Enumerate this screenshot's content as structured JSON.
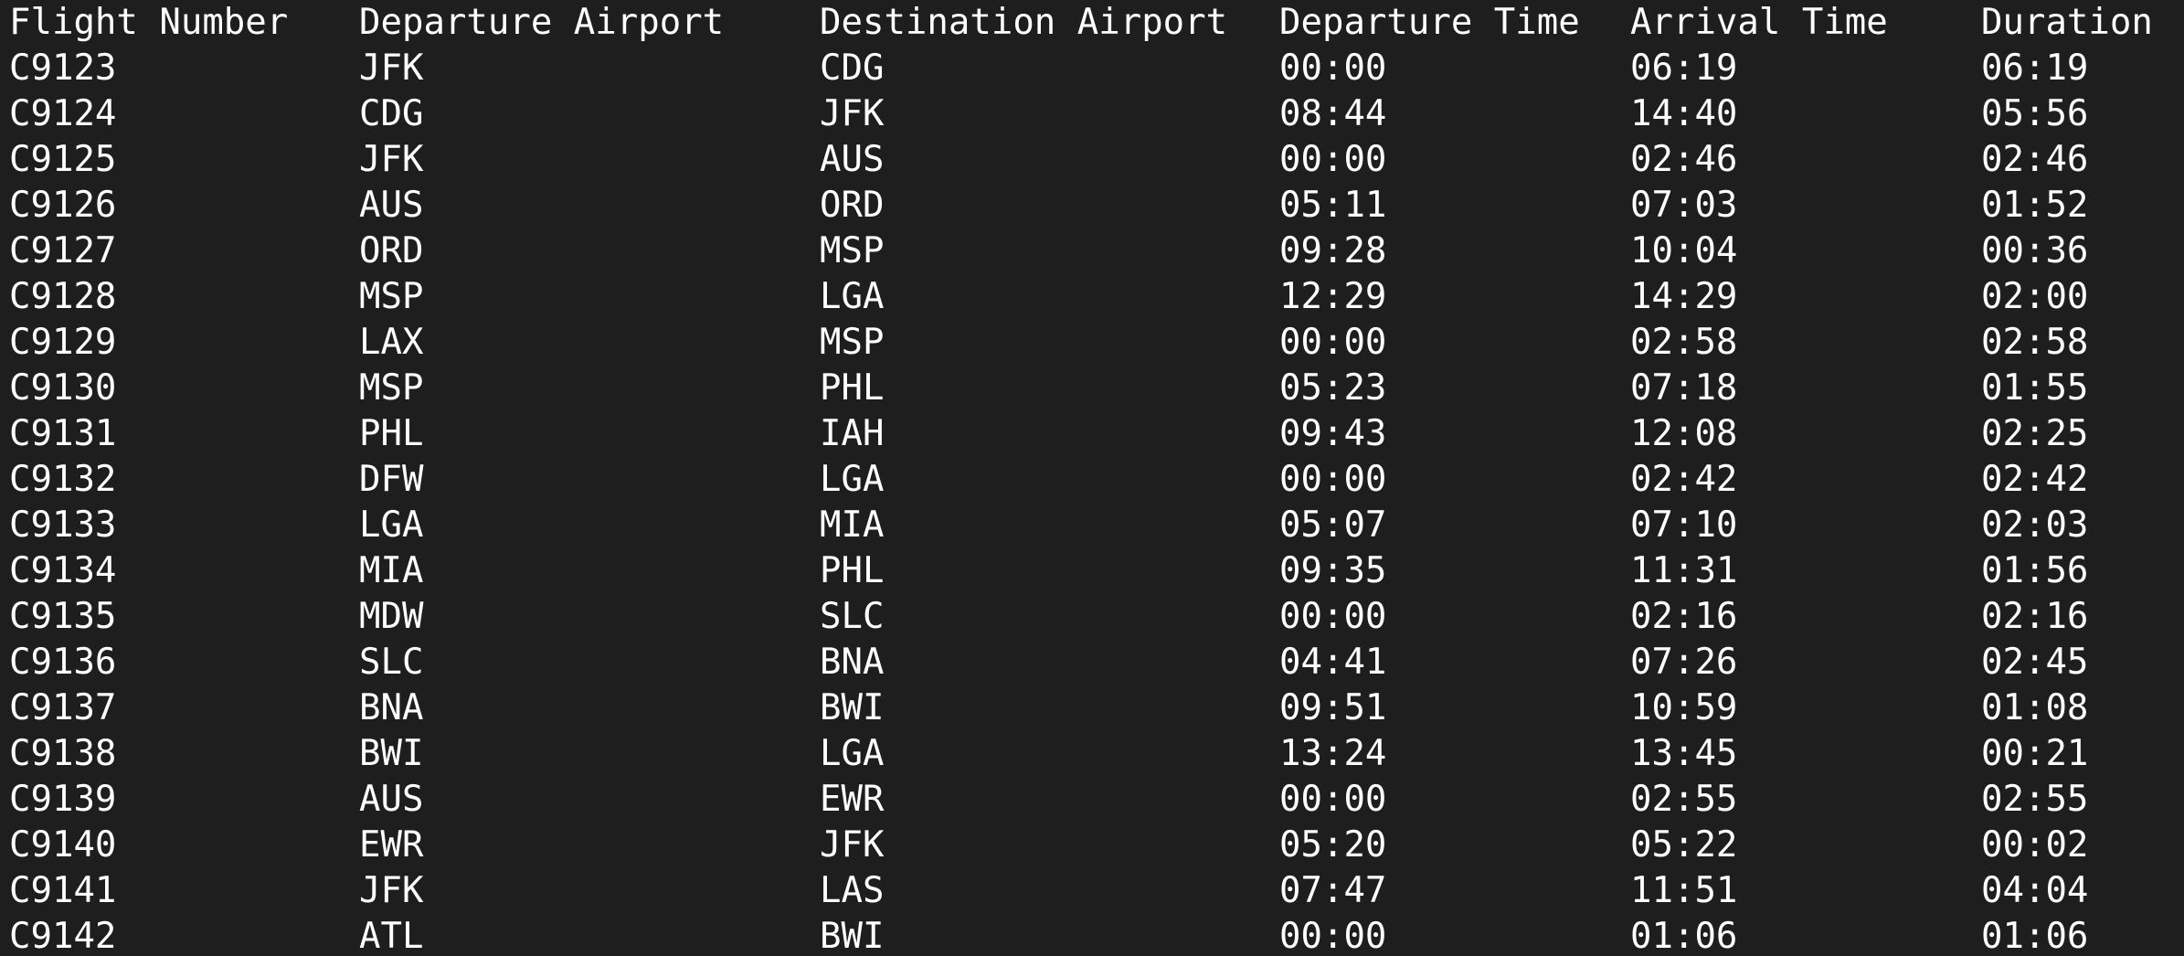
{
  "table": {
    "headers": [
      "Flight Number",
      "Departure Airport",
      "Destination Airport",
      "Departure Time",
      "Arrival Time",
      "Duration"
    ],
    "rows": [
      [
        "C9123",
        "JFK",
        "CDG",
        "00:00",
        "06:19",
        "06:19"
      ],
      [
        "C9124",
        "CDG",
        "JFK",
        "08:44",
        "14:40",
        "05:56"
      ],
      [
        "C9125",
        "JFK",
        "AUS",
        "00:00",
        "02:46",
        "02:46"
      ],
      [
        "C9126",
        "AUS",
        "ORD",
        "05:11",
        "07:03",
        "01:52"
      ],
      [
        "C9127",
        "ORD",
        "MSP",
        "09:28",
        "10:04",
        "00:36"
      ],
      [
        "C9128",
        "MSP",
        "LGA",
        "12:29",
        "14:29",
        "02:00"
      ],
      [
        "C9129",
        "LAX",
        "MSP",
        "00:00",
        "02:58",
        "02:58"
      ],
      [
        "C9130",
        "MSP",
        "PHL",
        "05:23",
        "07:18",
        "01:55"
      ],
      [
        "C9131",
        "PHL",
        "IAH",
        "09:43",
        "12:08",
        "02:25"
      ],
      [
        "C9132",
        "DFW",
        "LGA",
        "00:00",
        "02:42",
        "02:42"
      ],
      [
        "C9133",
        "LGA",
        "MIA",
        "05:07",
        "07:10",
        "02:03"
      ],
      [
        "C9134",
        "MIA",
        "PHL",
        "09:35",
        "11:31",
        "01:56"
      ],
      [
        "C9135",
        "MDW",
        "SLC",
        "00:00",
        "02:16",
        "02:16"
      ],
      [
        "C9136",
        "SLC",
        "BNA",
        "04:41",
        "07:26",
        "02:45"
      ],
      [
        "C9137",
        "BNA",
        "BWI",
        "09:51",
        "10:59",
        "01:08"
      ],
      [
        "C9138",
        "BWI",
        "LGA",
        "13:24",
        "13:45",
        "00:21"
      ],
      [
        "C9139",
        "AUS",
        "EWR",
        "00:00",
        "02:55",
        "02:55"
      ],
      [
        "C9140",
        "EWR",
        "JFK",
        "05:20",
        "05:22",
        "00:02"
      ],
      [
        "C9141",
        "JFK",
        "LAS",
        "07:47",
        "11:51",
        "04:04"
      ],
      [
        "C9142",
        "ATL",
        "BWI",
        "00:00",
        "01:06",
        "01:06"
      ]
    ]
  },
  "colors": {
    "background": "#1e1e1e",
    "text": "#ffffff"
  }
}
